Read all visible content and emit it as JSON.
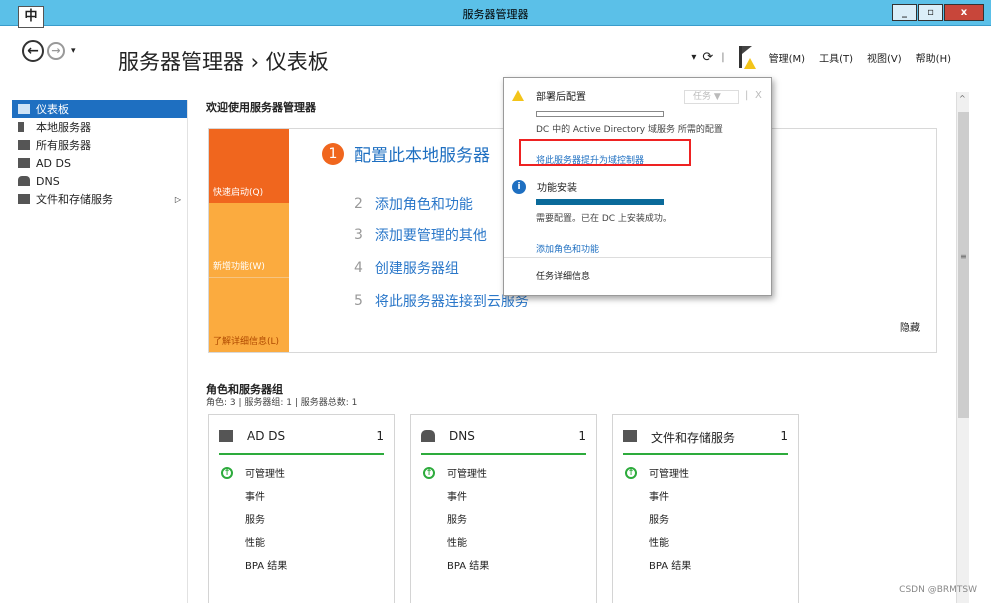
{
  "window": {
    "title": "服务器管理器",
    "ime": "中",
    "controls": {
      "minimize": "_",
      "restore": "▫",
      "close": "x"
    }
  },
  "header": {
    "breadcrumb": "服务器管理器 › 仪表板",
    "menus": [
      "管理(M)",
      "工具(T)",
      "视图(V)",
      "帮助(H)"
    ]
  },
  "sidebar": {
    "items": [
      {
        "label": "仪表板",
        "icon": "dashboard-icon"
      },
      {
        "label": "本地服务器",
        "icon": "server-icon"
      },
      {
        "label": "所有服务器",
        "icon": "servers-icon"
      },
      {
        "label": "AD DS",
        "icon": "ad-ds-icon"
      },
      {
        "label": "DNS",
        "icon": "dns-icon"
      },
      {
        "label": "文件和存储服务",
        "icon": "file-storage-icon"
      }
    ]
  },
  "main": {
    "welcome": "欢迎使用服务器管理器",
    "quick_start": {
      "side": [
        "快速启动(Q)",
        "新增功能(W)",
        "了解详细信息(L)"
      ],
      "step1_num": "1",
      "step1": "配置此本地服务器",
      "steps": [
        {
          "num": "2",
          "label": "添加角色和功能"
        },
        {
          "num": "3",
          "label": "添加要管理的其他"
        },
        {
          "num": "4",
          "label": "创建服务器组"
        },
        {
          "num": "5",
          "label": "将此服务器连接到云服务"
        }
      ],
      "hide": "隐藏"
    },
    "roles_title": "角色和服务器组",
    "roles_sub": "角色: 3 | 服务器组: 1 | 服务器总数: 1",
    "tiles": [
      {
        "name": "AD DS",
        "count": "1",
        "rows": [
          "可管理性",
          "事件",
          "服务",
          "性能",
          "BPA 结果"
        ]
      },
      {
        "name": "DNS",
        "count": "1",
        "rows": [
          "可管理性",
          "事件",
          "服务",
          "性能",
          "BPA 结果"
        ]
      },
      {
        "name": "文件和存储服务",
        "count": "1",
        "rows": [
          "可管理性",
          "事件",
          "服务",
          "性能",
          "BPA 结果"
        ]
      }
    ]
  },
  "popup": {
    "section1_title": "部署后配置",
    "tasks_label": "任务 ▼",
    "close": "X",
    "section1_desc": "DC 中的 Active Directory 域服务 所需的配置",
    "promote_link": "将此服务器提升为域控制器",
    "section2_title": "功能安装",
    "section2_desc": "需要配置。已在 DC 上安装成功。",
    "add_roles_link": "添加角色和功能",
    "task_details": "任务详细信息"
  },
  "watermark": "CSDN @BRMTSW"
}
